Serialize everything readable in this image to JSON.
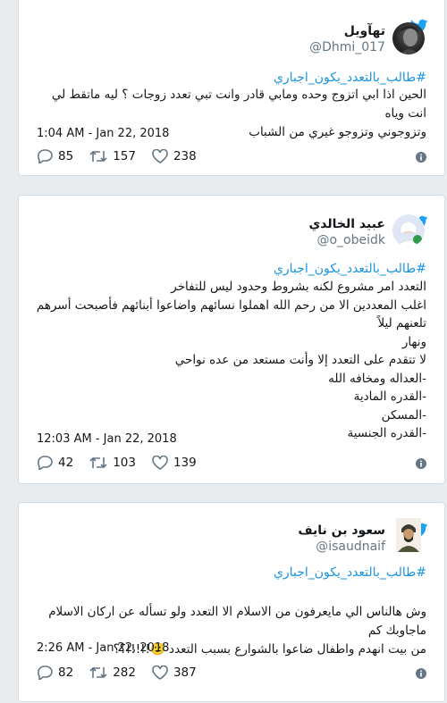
{
  "colors": {
    "accent": "#1da1f2",
    "link": "#1b95e0",
    "text": "#14171a",
    "muted": "#657786"
  },
  "tweets": [
    {
      "name": "تهآويل",
      "handle": "@Dhmi_017",
      "hashtag": "#طالب_بالتعدد_يكون_اجباري",
      "lines": [
        "الحين اذا ابي اتزوج وحده ومابي قادر وانت تبي تعدد زوجات ؟ ليه ماتقط لي انت وياه",
        "وتزوجوني وتزوجو غيري من الشباب"
      ],
      "time": "1:04 AM - Jan 22, 2018",
      "replies": "85",
      "retweets": "157",
      "likes": "238"
    },
    {
      "name": "عبيد الخالدي",
      "handle": "@o_obeidk",
      "hashtag": "#طالب_بالتعدد_يكون_اجباري",
      "lines": [
        "التعدد امر مشروع لكنه بشروط وحدود ليس  للتفاخر",
        "اغلب المعددين الا من رحم الله اهملوا نسائهم واضاعوا أبنائهم فأصبحت أسرهم تلعنهم ليلاً",
        "ونهار",
        "لا تتقدم على التعدد إلا وأنت مستعد من عده نواحي",
        "-العداله ومخافه الله",
        "-القدره المادية",
        "-المسكن",
        "-القدره الجنسية"
      ],
      "time": "12:03 AM - Jan 22, 2018",
      "replies": "42",
      "retweets": "103",
      "likes": "139"
    },
    {
      "name": "سعود بن نايف",
      "handle": "@isaudnaif",
      "hashtag": "#طالب_بالتعدد_يكون_اجباري",
      "lines": [
        "وش هالناس الي مايعرفون من الاسلام الا التعدد ولو تسأله عن اركان الاسلام ماجاوبك كم",
        "من بيت انهدم واطفال ضاعوا بالشوارع بسبب التعدد 🙂!!!!!؟؟"
      ],
      "time": "2:26 AM - Jan 22, 2018",
      "replies": "82",
      "retweets": "282",
      "likes": "387"
    }
  ],
  "icons": {
    "brand": "twitter-bird-icon",
    "reply": "reply-icon",
    "retweet": "retweet-icon",
    "like": "heart-icon",
    "info": "info-icon"
  }
}
